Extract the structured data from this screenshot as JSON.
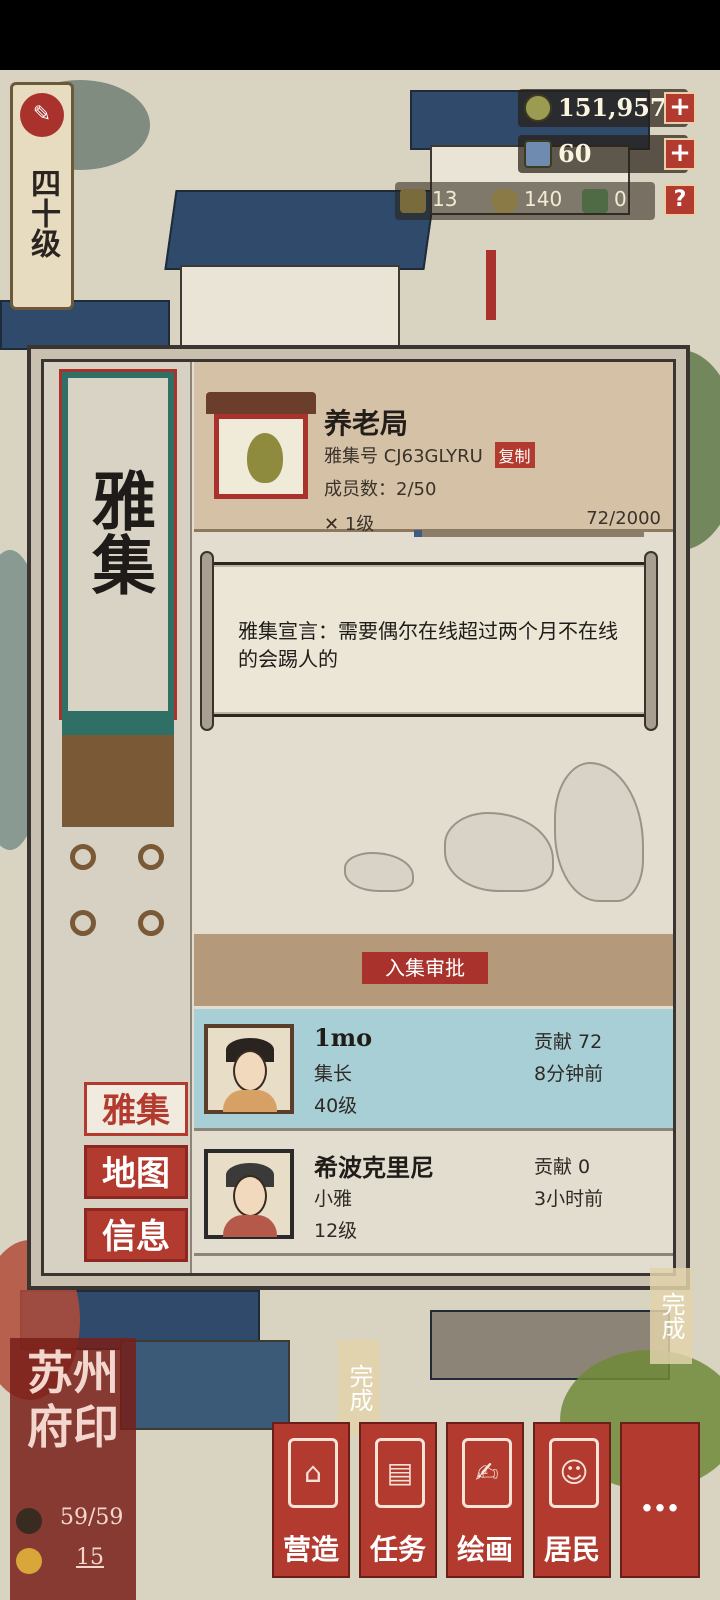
{
  "level": {
    "label": "四十级",
    "icon": "brush-icon"
  },
  "resources": {
    "coins": {
      "value": "151,957",
      "icon": "coin-icon"
    },
    "gems": {
      "value": "60",
      "icon": "jade-icon"
    },
    "mini": [
      {
        "value": "13",
        "icon": "bamboo-icon"
      },
      {
        "value": "140",
        "icon": "basket-icon"
      },
      {
        "value": "0",
        "icon": "book-icon"
      }
    ],
    "plus_label": "+",
    "help_label": "?"
  },
  "panel": {
    "side_title": "雅集",
    "side_buttons": [
      {
        "label": "雅集",
        "active": true
      },
      {
        "label": "地图",
        "active": false
      },
      {
        "label": "信息",
        "active": false
      }
    ]
  },
  "club": {
    "name": "养老局",
    "id_label": "雅集号",
    "id_value": "CJ63GLYRU",
    "copy_label": "复制",
    "members_label": "成员数：",
    "members_value": "2/50",
    "level": "1级",
    "exp": "72/2000",
    "exp_fraction": 0.036,
    "declaration": "雅集宣言：需要偶尔在线超过两个月不在线的会踢人的"
  },
  "approve_label": "入集审批",
  "members": [
    {
      "name": "1mo",
      "role": "集长",
      "level": "40级",
      "contrib": "贡献  72",
      "last_seen": "8分钟前",
      "highlight": true
    },
    {
      "name": "希波克里尼",
      "role": "小雅",
      "level": "12级",
      "contrib": "贡献  0",
      "last_seen": "3小时前",
      "highlight": false
    }
  ],
  "seal": {
    "title": "苏州府印",
    "stat1": "59/59",
    "stat2": "15"
  },
  "done_label": "完成",
  "nav": [
    {
      "label": "营造",
      "icon": "build-icon"
    },
    {
      "label": "任务",
      "icon": "task-icon"
    },
    {
      "label": "绘画",
      "icon": "scroll-icon"
    },
    {
      "label": "居民",
      "icon": "resident-icon"
    },
    {
      "label": "…",
      "icon": "more-icon"
    }
  ],
  "colors": {
    "accent_red": "#b23a2f",
    "panel_bg": "#e3ddd0",
    "highlight_row": "#a9cfd6",
    "teal": "#2f6f66"
  }
}
